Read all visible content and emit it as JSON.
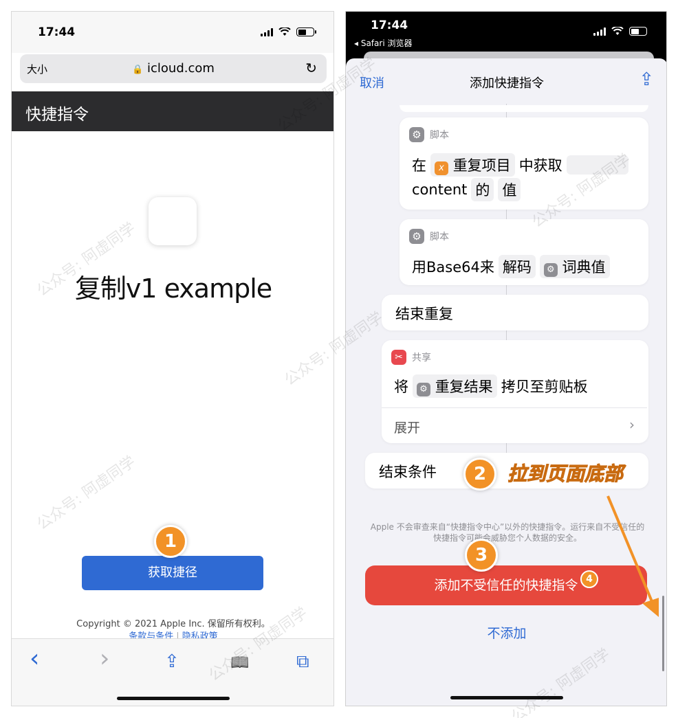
{
  "left_phone": {
    "status": {
      "time": "17:44"
    },
    "url_bar": {
      "text_size_label": "大小",
      "domain": "icloud.com",
      "reload_glyph": "↻"
    },
    "page_header": {
      "title": "快捷指令"
    },
    "shortcut": {
      "name": "复制v1 example"
    },
    "get_button": {
      "label": "获取捷径"
    },
    "footer": {
      "copyright": "Copyright © 2021 Apple Inc. 保留所有权利。",
      "terms": "条款与条件",
      "privacy": "隐私政策"
    },
    "toolbar": {
      "back_glyph": "‹",
      "forward_glyph": "›",
      "share_glyph": "⇪",
      "bookmarks_glyph": "📖",
      "tabs_glyph": "⧉"
    }
  },
  "right_phone": {
    "status": {
      "time": "17:44",
      "back_app": "◂ Safari 浏览器"
    },
    "nav": {
      "cancel": "取消",
      "title": "添加快捷指令",
      "share_glyph": "⇪"
    },
    "actions": [
      {
        "category": "脚本",
        "line1": [
          "在",
          "重复项目",
          "中获取"
        ],
        "line2": [
          "content",
          "的",
          "值"
        ]
      },
      {
        "category": "脚本",
        "line1": [
          "用Base64来",
          "解码",
          "词典值"
        ]
      },
      {
        "label": "结束重复"
      },
      {
        "category": "共享",
        "line1": [
          "将",
          "重复结果",
          "拷贝至剪贴板"
        ],
        "expand": "展开"
      },
      {
        "label": "结束条件"
      }
    ],
    "icons": {
      "gear": "⚙",
      "variable": "x",
      "scissors": "✂",
      "chevron": "›"
    },
    "warning": "Apple 不会审查来自“快捷指令中心”以外的快捷指令。运行来自不受信任的快捷指令可能会威胁您个人数据的安全。",
    "add_button": {
      "label": "添加不受信任的快捷指令"
    },
    "dont_add": {
      "label": "不添加"
    }
  },
  "annotations": {
    "step1": "1",
    "step2": "2",
    "step3": "3",
    "step4": "4",
    "callout": "拉到页面底部",
    "accent_color": "#f29227"
  },
  "watermark": "公众号: 阿虚同学"
}
